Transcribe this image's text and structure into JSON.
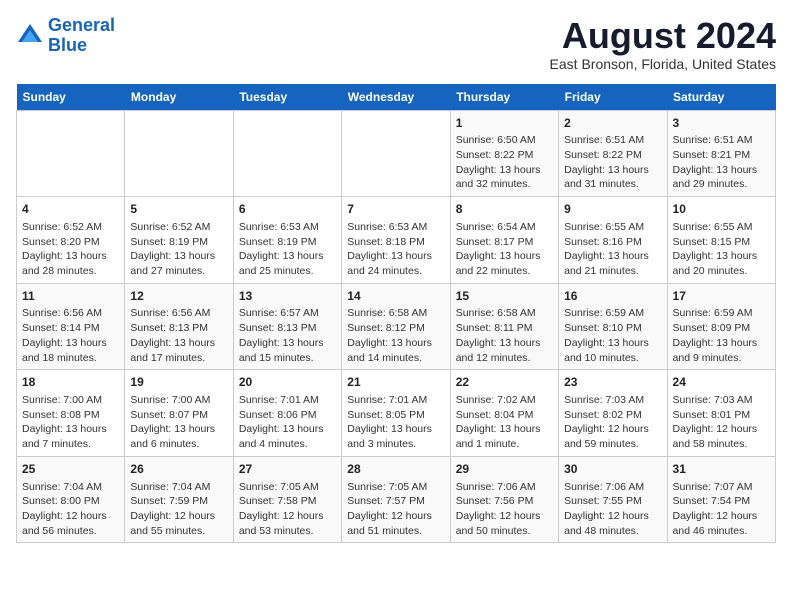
{
  "header": {
    "logo_line1": "General",
    "logo_line2": "Blue",
    "month_title": "August 2024",
    "location": "East Bronson, Florida, United States"
  },
  "weekdays": [
    "Sunday",
    "Monday",
    "Tuesday",
    "Wednesday",
    "Thursday",
    "Friday",
    "Saturday"
  ],
  "weeks": [
    [
      {
        "day": "",
        "info": ""
      },
      {
        "day": "",
        "info": ""
      },
      {
        "day": "",
        "info": ""
      },
      {
        "day": "",
        "info": ""
      },
      {
        "day": "1",
        "info": "Sunrise: 6:50 AM\nSunset: 8:22 PM\nDaylight: 13 hours\nand 32 minutes."
      },
      {
        "day": "2",
        "info": "Sunrise: 6:51 AM\nSunset: 8:22 PM\nDaylight: 13 hours\nand 31 minutes."
      },
      {
        "day": "3",
        "info": "Sunrise: 6:51 AM\nSunset: 8:21 PM\nDaylight: 13 hours\nand 29 minutes."
      }
    ],
    [
      {
        "day": "4",
        "info": "Sunrise: 6:52 AM\nSunset: 8:20 PM\nDaylight: 13 hours\nand 28 minutes."
      },
      {
        "day": "5",
        "info": "Sunrise: 6:52 AM\nSunset: 8:19 PM\nDaylight: 13 hours\nand 27 minutes."
      },
      {
        "day": "6",
        "info": "Sunrise: 6:53 AM\nSunset: 8:19 PM\nDaylight: 13 hours\nand 25 minutes."
      },
      {
        "day": "7",
        "info": "Sunrise: 6:53 AM\nSunset: 8:18 PM\nDaylight: 13 hours\nand 24 minutes."
      },
      {
        "day": "8",
        "info": "Sunrise: 6:54 AM\nSunset: 8:17 PM\nDaylight: 13 hours\nand 22 minutes."
      },
      {
        "day": "9",
        "info": "Sunrise: 6:55 AM\nSunset: 8:16 PM\nDaylight: 13 hours\nand 21 minutes."
      },
      {
        "day": "10",
        "info": "Sunrise: 6:55 AM\nSunset: 8:15 PM\nDaylight: 13 hours\nand 20 minutes."
      }
    ],
    [
      {
        "day": "11",
        "info": "Sunrise: 6:56 AM\nSunset: 8:14 PM\nDaylight: 13 hours\nand 18 minutes."
      },
      {
        "day": "12",
        "info": "Sunrise: 6:56 AM\nSunset: 8:13 PM\nDaylight: 13 hours\nand 17 minutes."
      },
      {
        "day": "13",
        "info": "Sunrise: 6:57 AM\nSunset: 8:13 PM\nDaylight: 13 hours\nand 15 minutes."
      },
      {
        "day": "14",
        "info": "Sunrise: 6:58 AM\nSunset: 8:12 PM\nDaylight: 13 hours\nand 14 minutes."
      },
      {
        "day": "15",
        "info": "Sunrise: 6:58 AM\nSunset: 8:11 PM\nDaylight: 13 hours\nand 12 minutes."
      },
      {
        "day": "16",
        "info": "Sunrise: 6:59 AM\nSunset: 8:10 PM\nDaylight: 13 hours\nand 10 minutes."
      },
      {
        "day": "17",
        "info": "Sunrise: 6:59 AM\nSunset: 8:09 PM\nDaylight: 13 hours\nand 9 minutes."
      }
    ],
    [
      {
        "day": "18",
        "info": "Sunrise: 7:00 AM\nSunset: 8:08 PM\nDaylight: 13 hours\nand 7 minutes."
      },
      {
        "day": "19",
        "info": "Sunrise: 7:00 AM\nSunset: 8:07 PM\nDaylight: 13 hours\nand 6 minutes."
      },
      {
        "day": "20",
        "info": "Sunrise: 7:01 AM\nSunset: 8:06 PM\nDaylight: 13 hours\nand 4 minutes."
      },
      {
        "day": "21",
        "info": "Sunrise: 7:01 AM\nSunset: 8:05 PM\nDaylight: 13 hours\nand 3 minutes."
      },
      {
        "day": "22",
        "info": "Sunrise: 7:02 AM\nSunset: 8:04 PM\nDaylight: 13 hours\nand 1 minute."
      },
      {
        "day": "23",
        "info": "Sunrise: 7:03 AM\nSunset: 8:02 PM\nDaylight: 12 hours\nand 59 minutes."
      },
      {
        "day": "24",
        "info": "Sunrise: 7:03 AM\nSunset: 8:01 PM\nDaylight: 12 hours\nand 58 minutes."
      }
    ],
    [
      {
        "day": "25",
        "info": "Sunrise: 7:04 AM\nSunset: 8:00 PM\nDaylight: 12 hours\nand 56 minutes."
      },
      {
        "day": "26",
        "info": "Sunrise: 7:04 AM\nSunset: 7:59 PM\nDaylight: 12 hours\nand 55 minutes."
      },
      {
        "day": "27",
        "info": "Sunrise: 7:05 AM\nSunset: 7:58 PM\nDaylight: 12 hours\nand 53 minutes."
      },
      {
        "day": "28",
        "info": "Sunrise: 7:05 AM\nSunset: 7:57 PM\nDaylight: 12 hours\nand 51 minutes."
      },
      {
        "day": "29",
        "info": "Sunrise: 7:06 AM\nSunset: 7:56 PM\nDaylight: 12 hours\nand 50 minutes."
      },
      {
        "day": "30",
        "info": "Sunrise: 7:06 AM\nSunset: 7:55 PM\nDaylight: 12 hours\nand 48 minutes."
      },
      {
        "day": "31",
        "info": "Sunrise: 7:07 AM\nSunset: 7:54 PM\nDaylight: 12 hours\nand 46 minutes."
      }
    ]
  ]
}
